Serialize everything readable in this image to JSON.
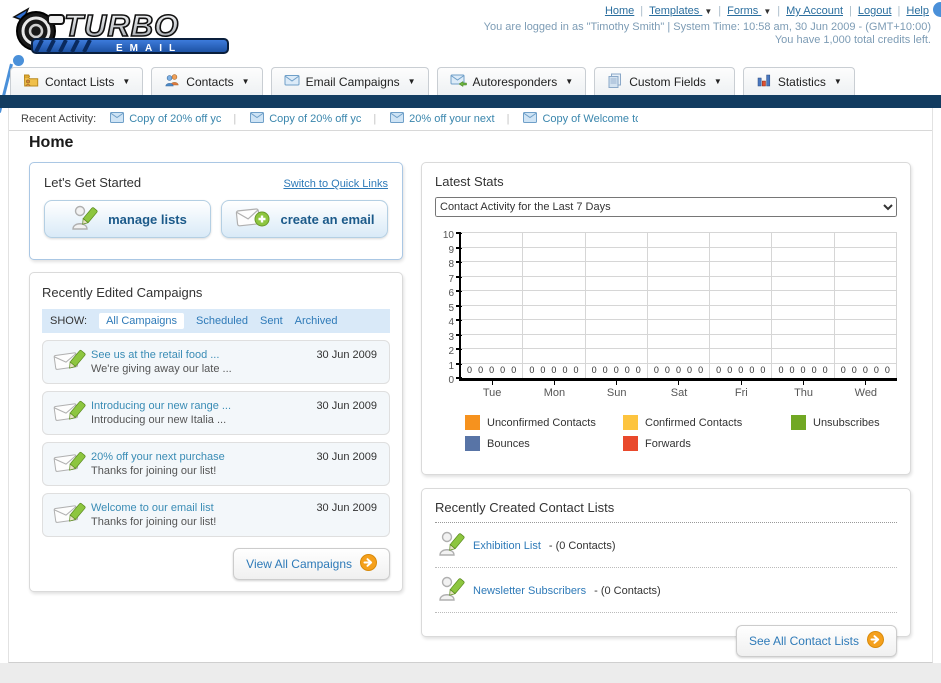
{
  "header": {
    "logo": {
      "title": "TURBO",
      "subtitle": "EMAIL"
    },
    "nav": [
      {
        "label": "Home",
        "dropdown": false
      },
      {
        "label": "Templates",
        "dropdown": true
      },
      {
        "label": "Forms",
        "dropdown": true
      },
      {
        "label": "My Account",
        "dropdown": false
      },
      {
        "label": "Logout",
        "dropdown": false
      },
      {
        "label": "Help",
        "dropdown": false
      }
    ],
    "login_line": "You are logged in as \"Timothy Smith\" | System Time: 10:58 am, 30 Jun 2009 - (GMT+10:00)",
    "credits_line": "You have 1,000 total credits left."
  },
  "tabs": [
    {
      "label": "Contact Lists",
      "icon": "folder-icon"
    },
    {
      "label": "Contacts",
      "icon": "contacts-icon"
    },
    {
      "label": "Email Campaigns",
      "icon": "envelope-icon"
    },
    {
      "label": "Autoresponders",
      "icon": "envelope-arrow-icon"
    },
    {
      "label": "Custom Fields",
      "icon": "pages-icon"
    },
    {
      "label": "Statistics",
      "icon": "barchart-icon"
    }
  ],
  "recent_activity": {
    "label": "Recent Activity:",
    "items": [
      "Copy of 20% off yc",
      "Copy of 20% off yc",
      "20% off your next",
      "Copy of Welcome tc"
    ]
  },
  "page_title": "Home",
  "get_started": {
    "title": "Let's Get Started",
    "switch_link": "Switch to Quick Links",
    "buttons": [
      {
        "label": "manage lists",
        "icon": "person-pencil-icon"
      },
      {
        "label": "create an email",
        "icon": "envelope-plus-icon"
      }
    ]
  },
  "campaigns": {
    "title": "Recently Edited Campaigns",
    "show_label": "SHOW:",
    "filters": [
      {
        "label": "All Campaigns",
        "active": true
      },
      {
        "label": "Scheduled",
        "active": false
      },
      {
        "label": "Sent",
        "active": false
      },
      {
        "label": "Archived",
        "active": false
      }
    ],
    "items": [
      {
        "title": "See us at the retail food ...",
        "subtitle": "We're giving away our late ...",
        "date": "30 Jun 2009"
      },
      {
        "title": "Introducing our new range ...",
        "subtitle": "Introducing our new Italia ...",
        "date": "30 Jun 2009"
      },
      {
        "title": "20% off your next purchase",
        "subtitle": "Thanks for joining our list!",
        "date": "30 Jun 2009"
      },
      {
        "title": "Welcome to our email list",
        "subtitle": "Thanks for joining our list!",
        "date": "30 Jun 2009"
      }
    ],
    "view_all_label": "View All Campaigns"
  },
  "stats": {
    "title": "Latest Stats",
    "dropdown_value": "Contact Activity for the Last 7 Days"
  },
  "chart_data": {
    "type": "bar",
    "title": "Contact Activity for the Last 7 Days",
    "categories": [
      "Tue",
      "Mon",
      "Sun",
      "Sat",
      "Fri",
      "Thu",
      "Wed"
    ],
    "series": [
      {
        "name": "Unconfirmed Contacts",
        "color": "#f6921e",
        "values": [
          0,
          0,
          0,
          0,
          0,
          0,
          0
        ]
      },
      {
        "name": "Confirmed Contacts",
        "color": "#fdc43f",
        "values": [
          0,
          0,
          0,
          0,
          0,
          0,
          0
        ]
      },
      {
        "name": "Unsubscribes",
        "color": "#71a823",
        "values": [
          0,
          0,
          0,
          0,
          0,
          0,
          0
        ]
      },
      {
        "name": "Bounces",
        "color": "#5874a6",
        "values": [
          0,
          0,
          0,
          0,
          0,
          0,
          0
        ]
      },
      {
        "name": "Forwards",
        "color": "#e9492c",
        "values": [
          0,
          0,
          0,
          0,
          0,
          0,
          0
        ]
      }
    ],
    "ylim": [
      0,
      10
    ],
    "yticks": [
      0,
      1,
      2,
      3,
      4,
      5,
      6,
      7,
      8,
      9,
      10
    ],
    "grid": true,
    "legend_position": "bottom",
    "data_labels_shown": true
  },
  "contact_lists": {
    "title": "Recently Created Contact Lists",
    "items": [
      {
        "name": "Exhibition List",
        "count": "- (0 Contacts)"
      },
      {
        "name": "Newsletter Subscribers",
        "count": "- (0 Contacts)"
      }
    ],
    "see_all_label": "See All Contact Lists"
  },
  "colors": {
    "navy_bar": "#123c60",
    "link_blue": "#2e7ab8",
    "panel_blue_border": "#aac7e4",
    "accent_orange": "#f5a01c",
    "pin_blue": "#4a90d9"
  }
}
